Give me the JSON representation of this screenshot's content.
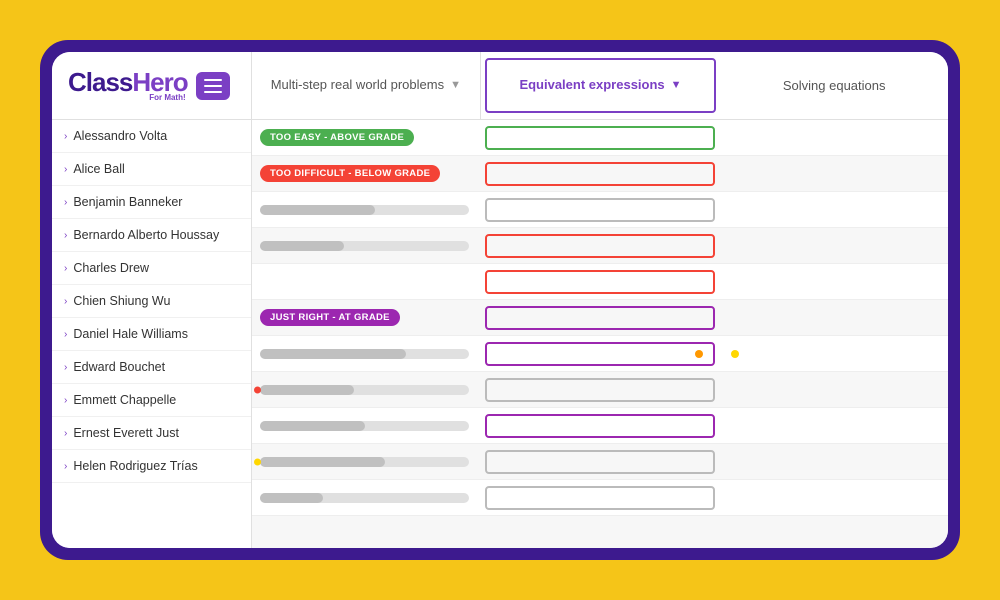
{
  "logo": {
    "for_math": "For Math!",
    "class": "Class",
    "hero": "Hero"
  },
  "header": {
    "tabs": [
      {
        "id": "tab1",
        "label": "Multi-step real world problems",
        "active": false,
        "has_chevron": true
      },
      {
        "id": "tab2",
        "label": "Equivalent expressions",
        "active": true,
        "has_chevron": true
      },
      {
        "id": "tab3",
        "label": "Solving equations",
        "active": false,
        "has_chevron": false
      }
    ]
  },
  "students": [
    {
      "name": "Alessandro Volta",
      "col1_type": "badge_green",
      "col2_type": "outlined_green"
    },
    {
      "name": "Alice Ball",
      "col1_type": "badge_red",
      "col2_type": "outlined_red"
    },
    {
      "name": "Benjamin Banneker",
      "col1_type": "bar_gray",
      "col2_type": "outlined_gray"
    },
    {
      "name": "Bernardo Alberto Houssay",
      "col1_type": "bar_gray",
      "col2_type": "outlined_red"
    },
    {
      "name": "Charles Drew",
      "col1_type": "bar_none",
      "col2_type": "outlined_red"
    },
    {
      "name": "Chien Shiung Wu",
      "col1_type": "badge_purple",
      "col2_type": "outlined_purple"
    },
    {
      "name": "Daniel Hale Williams",
      "col1_type": "bar_gray_dot_yellow",
      "col2_type": "outlined_purple_dot_orange"
    },
    {
      "name": "Edward Bouchet",
      "col1_type": "bar_gray_dot_red",
      "col2_type": "outlined_gray"
    },
    {
      "name": "Emmett Chappelle",
      "col1_type": "bar_gray",
      "col2_type": "outlined_purple"
    },
    {
      "name": "Ernest Everett Just",
      "col1_type": "bar_gray_dot_yellow2",
      "col2_type": "outlined_gray"
    },
    {
      "name": "Helen Rodriguez Trías",
      "col1_type": "bar_gray_short",
      "col2_type": "outlined_gray"
    }
  ],
  "badges": {
    "too_easy": "TOO EASY - ABOVE GRADE",
    "too_difficult": "TOO DIFFICULT - BELOW GRADE",
    "just_right": "JUST RIGHT - AT GRADE"
  },
  "colors": {
    "brand_purple": "#7B3FC4",
    "brand_dark": "#3D1A8E",
    "green": "#4CAF50",
    "red": "#F44336",
    "purple": "#9C27B0",
    "yellow": "#F5C518"
  }
}
